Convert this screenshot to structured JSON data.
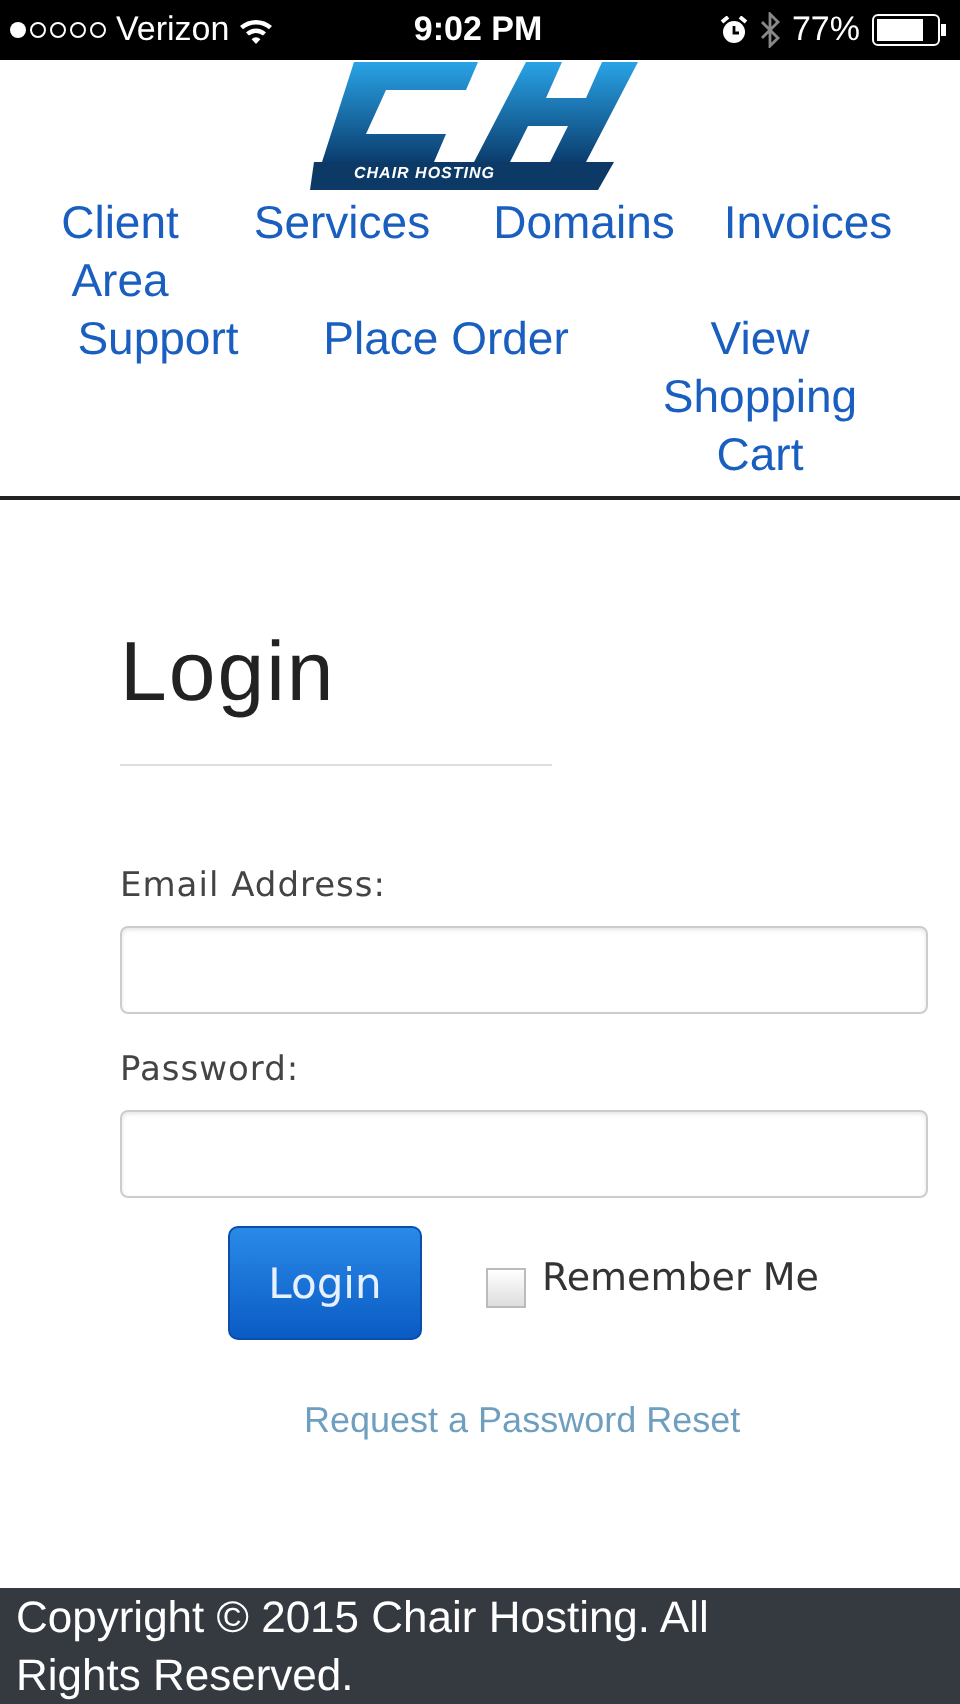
{
  "status_bar": {
    "carrier": "Verizon",
    "time": "9:02 PM",
    "battery": "77%"
  },
  "logo": {
    "text": "CHAIR HOSTING"
  },
  "nav": {
    "items": [
      {
        "label": "Client Area"
      },
      {
        "label": "Services"
      },
      {
        "label": "Domains"
      },
      {
        "label": "Invoices"
      },
      {
        "label": "Support"
      },
      {
        "label": "Place Order"
      },
      {
        "label": "View Shopping Cart"
      }
    ]
  },
  "login": {
    "title": "Login",
    "email_label": "Email Address:",
    "password_label": "Password:",
    "button": "Login",
    "remember": {
      "label": "Remember Me",
      "checked": false
    },
    "reset_link": "Request a Password Reset"
  },
  "footer": {
    "text": "Copyright © 2015 Chair Hosting. All Rights Reserved."
  }
}
